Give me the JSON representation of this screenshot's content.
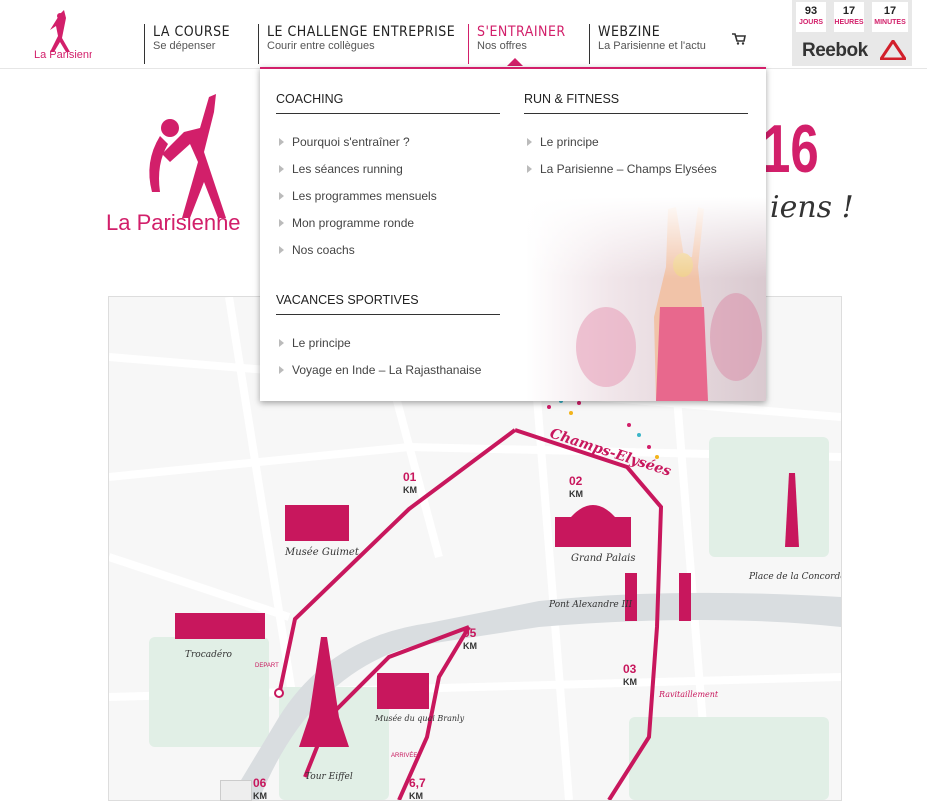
{
  "nav": {
    "items": [
      {
        "title": "LA COURSE",
        "sub": "Se dépenser"
      },
      {
        "title": "LE CHALLENGE ENTREPRISE",
        "sub": "Courir entre collègues"
      },
      {
        "title": "S'ENTRAINER",
        "sub": "Nos offres"
      },
      {
        "title": "WEBZINE",
        "sub": "La Parisienne et l'actu"
      }
    ]
  },
  "countdown": {
    "days": "93",
    "days_label": "JOURS",
    "hours": "17",
    "hours_label": "HEURES",
    "minutes": "17",
    "minutes_label": "MINUTES",
    "sponsor": "Reebok"
  },
  "hero": {
    "logo_text": "La Parisienne",
    "year_fragment": "16",
    "tagline_fragment": "iens !"
  },
  "dropdown": {
    "coaching": {
      "heading": "COACHING",
      "items": [
        "Pourquoi s'entraîner ?",
        "Les séances running",
        "Les programmes mensuels",
        "Mon programme ronde",
        "Nos coachs"
      ]
    },
    "run_fitness": {
      "heading": "RUN & FITNESS",
      "items": [
        "Le principe",
        "La Parisienne – Champs Elysées"
      ]
    },
    "vacances": {
      "heading": "VACANCES SPORTIVES",
      "items": [
        "Le principe",
        "Voyage en Inde – La Rajasthanaise"
      ]
    }
  },
  "map": {
    "labels": {
      "champs": "Champs-Elysées",
      "guimet": "Musée Guimet",
      "grand_palais": "Grand Palais",
      "concorde": "Place de la Concorde",
      "pont": "Pont Alexandre III",
      "trocadero": "Trocadéro",
      "depart": "DEPART",
      "branly": "Musée du quai Branly",
      "ravitaillement": "Ravitaillement",
      "eiffel": "Tour Eiffel",
      "arrivee": "ARRIVÉE",
      "km_unit": "KM"
    },
    "km": [
      "01",
      "02",
      "05",
      "03",
      "06",
      "6,7"
    ]
  },
  "colors": {
    "accent": "#d21f6a",
    "route": "#c8175d",
    "water": "#d9dde0",
    "park": "#e1efe6"
  }
}
